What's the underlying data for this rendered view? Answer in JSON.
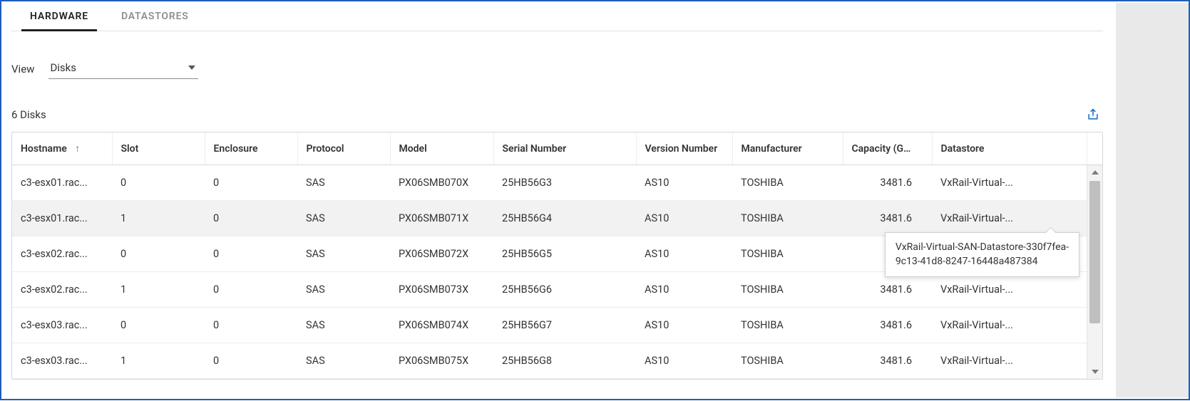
{
  "tabs": {
    "hardware": "HARDWARE",
    "datastores": "DATASTORES",
    "active": "hardware"
  },
  "view": {
    "label": "View",
    "selected": "Disks"
  },
  "count_text": "6 Disks",
  "export_icon_name": "export-icon",
  "columns": {
    "hostname": "Hostname",
    "slot": "Slot",
    "enclosure": "Enclosure",
    "protocol": "Protocol",
    "model": "Model",
    "serial": "Serial Number",
    "version": "Version Number",
    "manufacturer": "Manufacturer",
    "capacity": "Capacity (GB)",
    "datastore": "Datastore"
  },
  "sort_indicator": "↑",
  "rows": [
    {
      "hostname": "c3-esx01.rac...",
      "slot": "0",
      "enclosure": "0",
      "protocol": "SAS",
      "model": "PX06SMB070X",
      "serial": "25HB56G3",
      "version": "AS10",
      "manufacturer": "TOSHIBA",
      "capacity": "3481.6",
      "datastore": "VxRail-Virtual-..."
    },
    {
      "hostname": "c3-esx01.rac...",
      "slot": "1",
      "enclosure": "0",
      "protocol": "SAS",
      "model": "PX06SMB071X",
      "serial": "25HB56G4",
      "version": "AS10",
      "manufacturer": "TOSHIBA",
      "capacity": "3481.6",
      "datastore": "VxRail-Virtual-..."
    },
    {
      "hostname": "c3-esx02.rac...",
      "slot": "0",
      "enclosure": "0",
      "protocol": "SAS",
      "model": "PX06SMB072X",
      "serial": "25HB56G5",
      "version": "AS10",
      "manufacturer": "TOSHIBA",
      "capacity": "",
      "datastore": ""
    },
    {
      "hostname": "c3-esx02.rac...",
      "slot": "1",
      "enclosure": "0",
      "protocol": "SAS",
      "model": "PX06SMB073X",
      "serial": "25HB56G6",
      "version": "AS10",
      "manufacturer": "TOSHIBA",
      "capacity": "3481.6",
      "datastore": "VxRail-Virtual-..."
    },
    {
      "hostname": "c3-esx03.rac...",
      "slot": "0",
      "enclosure": "0",
      "protocol": "SAS",
      "model": "PX06SMB074X",
      "serial": "25HB56G7",
      "version": "AS10",
      "manufacturer": "TOSHIBA",
      "capacity": "3481.6",
      "datastore": "VxRail-Virtual-..."
    },
    {
      "hostname": "c3-esx03.rac...",
      "slot": "1",
      "enclosure": "0",
      "protocol": "SAS",
      "model": "PX06SMB075X",
      "serial": "25HB56G8",
      "version": "AS10",
      "manufacturer": "TOSHIBA",
      "capacity": "3481.6",
      "datastore": "VxRail-Virtual-..."
    }
  ],
  "selected_row_index": 1,
  "tooltip": {
    "line1": "VxRail-Virtual-SAN-Datastore-330f7fea-",
    "line2": "9c13-41d8-8247-16448a487384"
  }
}
